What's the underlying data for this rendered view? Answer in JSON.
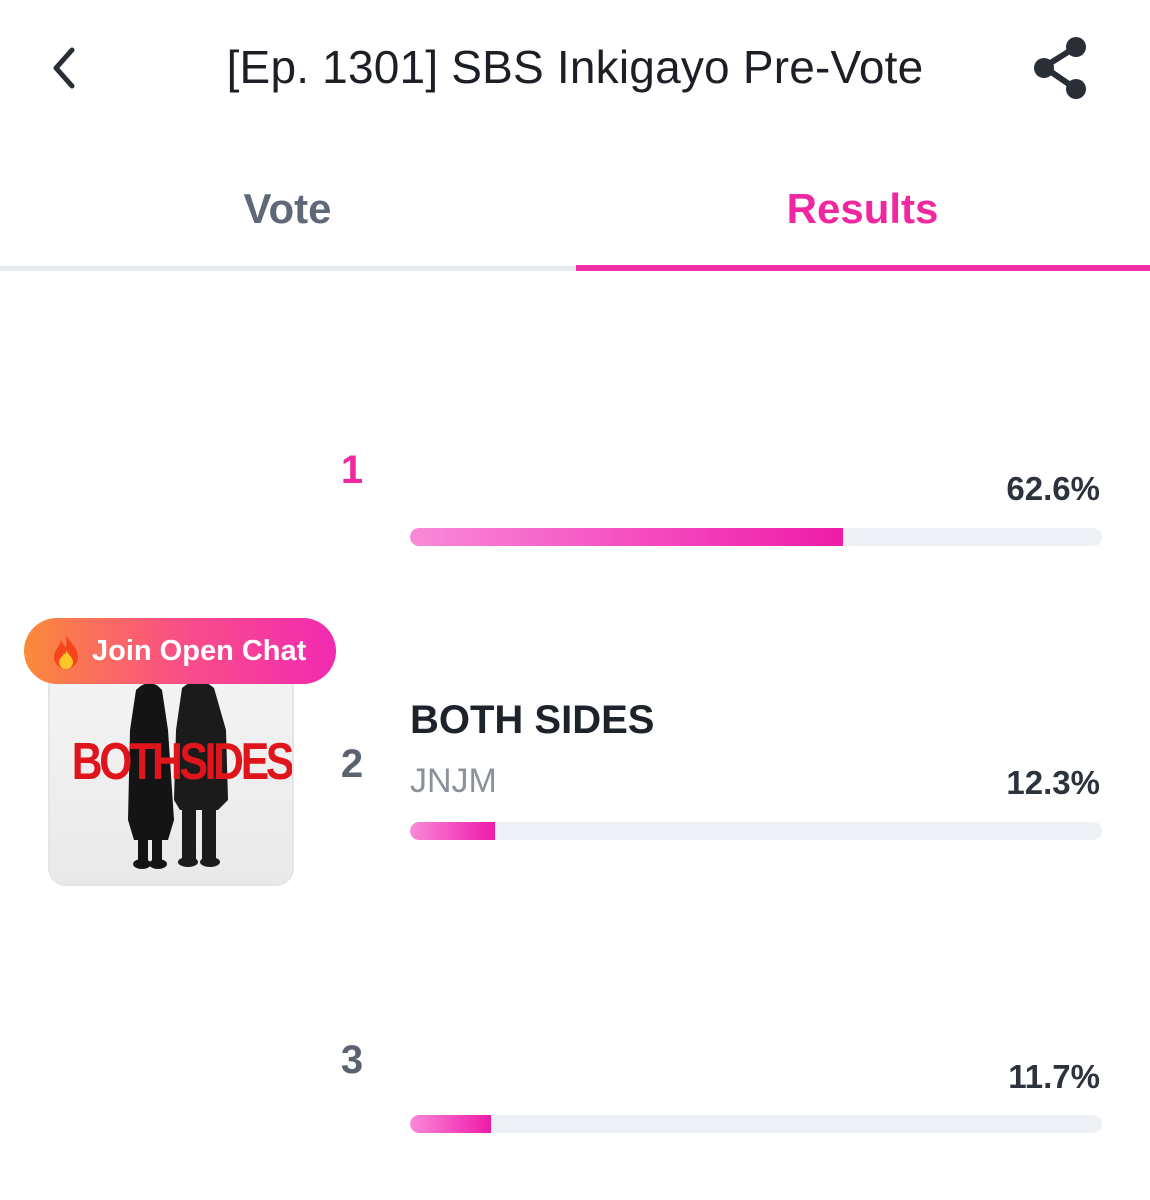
{
  "header": {
    "title": "[Ep. 1301] SBS Inkigayo Pre-Vote",
    "back_icon": "chevron-left-icon",
    "share_icon": "share-icon"
  },
  "tabs": [
    {
      "label": "Vote",
      "active": false
    },
    {
      "label": "Results",
      "active": true
    }
  ],
  "results": [
    {
      "rank": "1",
      "title": "",
      "artist": "",
      "percent_label": "62.6%",
      "percent": 62.6
    },
    {
      "rank": "2",
      "title": "BOTH SIDES",
      "artist": "JNJM",
      "percent_label": "12.3%",
      "percent": 12.3,
      "album_art_text": "BOTHSIDES"
    },
    {
      "rank": "3",
      "title": "",
      "artist": "",
      "percent_label": "11.7%",
      "percent": 11.7
    }
  ],
  "open_chat": {
    "label": "Join Open Chat",
    "icon": "fire-icon"
  },
  "colors": {
    "accent": "#f0279f",
    "bar_track": "#edf0f4",
    "tab_inactive": "#5f6877",
    "album_text": "#e0141b"
  }
}
